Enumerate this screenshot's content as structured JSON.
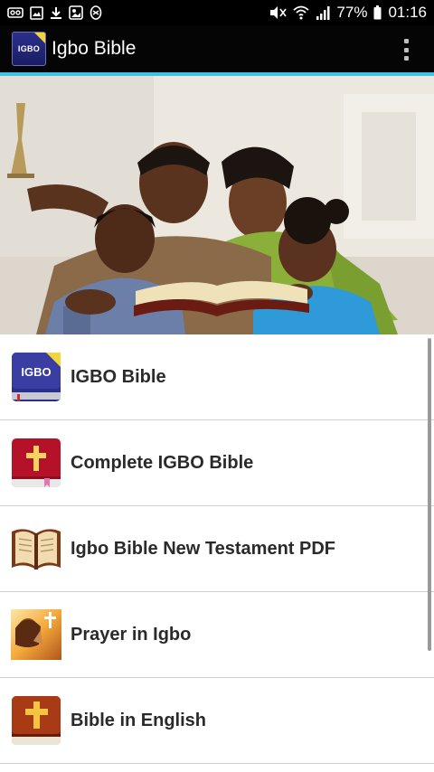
{
  "status_bar": {
    "battery_percent": "77%",
    "time": "01:16",
    "icons": [
      "voicemail-icon",
      "image-icon",
      "download-icon",
      "gallery-icon",
      "app-icon",
      "mute-icon",
      "wifi-icon",
      "signal-icon",
      "battery-icon"
    ]
  },
  "app_bar": {
    "logo_text": "IGBO",
    "title": "Igbo Bible",
    "menu_icon": "overflow-menu-icon"
  },
  "hero": {
    "icon": "family-reading-bible-image"
  },
  "menu": {
    "items": [
      {
        "label": "IGBO Bible",
        "icon": "igbo-bible-icon",
        "icon_text": "IGBO"
      },
      {
        "label": "Complete IGBO Bible",
        "icon": "red-bible-cross-icon"
      },
      {
        "label": "Igbo Bible New Testament PDF",
        "icon": "open-book-icon"
      },
      {
        "label": "Prayer in Igbo",
        "icon": "praying-woman-icon"
      },
      {
        "label": "Bible in English",
        "icon": "brown-bible-cross-icon"
      }
    ]
  },
  "colors": {
    "app_bar": "#050505",
    "accent_line": "#3ec3e6",
    "list_text": "#2a2a2a",
    "divider": "#cfcfcf"
  }
}
